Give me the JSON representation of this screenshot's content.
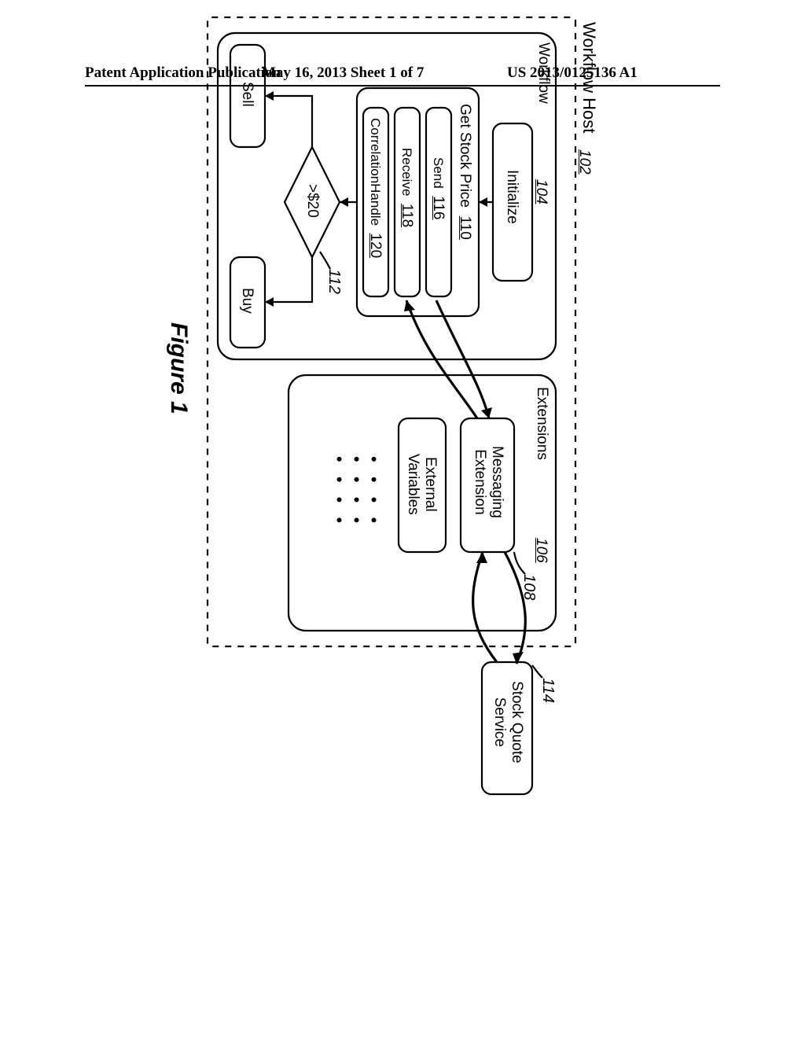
{
  "header": {
    "left": "Patent Application Publication",
    "center": "May 16, 2013  Sheet 1 of 7",
    "right": "US 2013/0125136 A1"
  },
  "figure": {
    "caption": "Figure 1",
    "host_title": "Workflow Host",
    "refs": {
      "workflow_host": "102",
      "workflow_panel": "104",
      "extensions_panel": "106",
      "messaging_ext": "108",
      "get_stock_price": "110",
      "decision": "112",
      "stock_service": "114",
      "send": "116",
      "receive": "118",
      "correlation": "120"
    },
    "workflow": {
      "panel_label": "Workflow",
      "initialize": "Initialize",
      "get_stock_price": "Get Stock Price",
      "send": "Send",
      "receive": "Receive",
      "correlation": "CorrelationHandle",
      "decision": ">$20",
      "sell": "Sell",
      "buy": "Buy"
    },
    "extensions": {
      "panel_label": "Extensions",
      "messaging": "Messaging\nExtension",
      "ext_vars": "External\nVariables",
      "ellipsis": "•  •  •  •"
    },
    "stock_service": "Stock Quote\nService"
  }
}
